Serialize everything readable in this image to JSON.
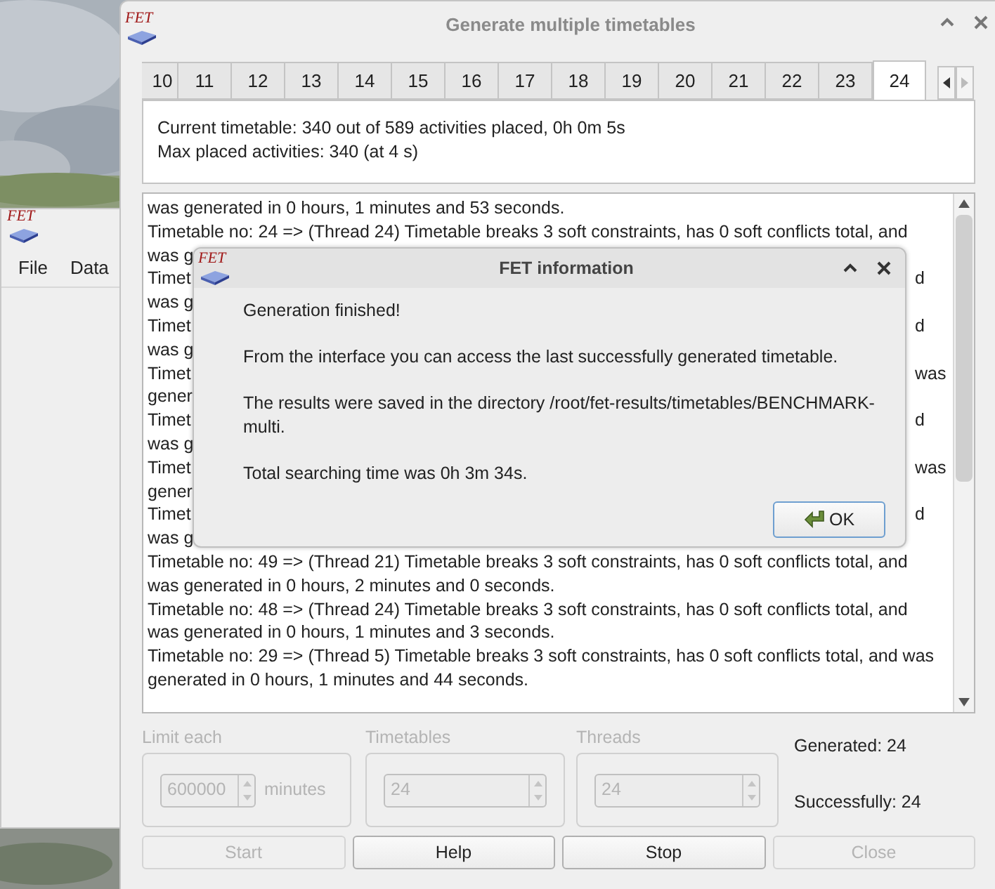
{
  "back_window": {
    "logo": "FET",
    "menu": [
      "File",
      "Data"
    ]
  },
  "window": {
    "logo": "FET",
    "title": "Generate multiple timetables"
  },
  "tabs": [
    {
      "label": "10",
      "selected": false
    },
    {
      "label": "11",
      "selected": false
    },
    {
      "label": "12",
      "selected": false
    },
    {
      "label": "13",
      "selected": false
    },
    {
      "label": "14",
      "selected": false
    },
    {
      "label": "15",
      "selected": false
    },
    {
      "label": "16",
      "selected": false
    },
    {
      "label": "17",
      "selected": false
    },
    {
      "label": "18",
      "selected": false
    },
    {
      "label": "19",
      "selected": false
    },
    {
      "label": "20",
      "selected": false
    },
    {
      "label": "21",
      "selected": false
    },
    {
      "label": "22",
      "selected": false
    },
    {
      "label": "23",
      "selected": false
    },
    {
      "label": "24",
      "selected": true
    }
  ],
  "status": [
    "Current timetable: 340 out of 589 activities placed, 0h 0m 5s",
    "Max placed activities: 340 (at 4 s)"
  ],
  "log": [
    {
      "left": "was generated in 0 hours, 1 minutes and 53 seconds."
    },
    {
      "left": "Timetable no: 24 => (Thread 24) Timetable breaks 3 soft constraints, has 0 soft conflicts total, and"
    },
    {
      "left": "was g"
    },
    {
      "left": "Timet",
      "right": "d"
    },
    {
      "left": "was g"
    },
    {
      "left": "Timet",
      "right": "d"
    },
    {
      "left": "was g"
    },
    {
      "left": "Timet",
      "right": "was"
    },
    {
      "left": "gener"
    },
    {
      "left": "Timet",
      "right": "d"
    },
    {
      "left": "was g"
    },
    {
      "left": "Timet",
      "right": "was"
    },
    {
      "left": "gener"
    },
    {
      "left": "Timet",
      "right": "d"
    },
    {
      "left": "was g"
    },
    {
      "left": "Timetable no: 49 => (Thread 21) Timetable breaks 3 soft constraints, has 0 soft conflicts total, and"
    },
    {
      "left": "was generated in 0 hours, 2 minutes and 0 seconds."
    },
    {
      "left": "Timetable no: 48 => (Thread 24) Timetable breaks 3 soft constraints, has 0 soft conflicts total, and"
    },
    {
      "left": "was generated in 0 hours, 1 minutes and 3 seconds."
    },
    {
      "left": "Timetable no: 29 => (Thread 5) Timetable breaks 3 soft constraints, has 0 soft conflicts total, and was"
    },
    {
      "left": "generated in 0 hours, 1 minutes and 44 seconds."
    }
  ],
  "settings": [
    {
      "label": "Limit each",
      "value": "600000",
      "unit": "minutes",
      "disabled": true
    },
    {
      "label": "Timetables",
      "value": "24",
      "disabled": true
    },
    {
      "label": "Threads",
      "value": "24",
      "disabled": true
    }
  ],
  "counters": [
    "Generated: 24",
    "Successfully: 24"
  ],
  "buttons": [
    {
      "label": "Start",
      "disabled": true
    },
    {
      "label": "Help",
      "disabled": false
    },
    {
      "label": "Stop",
      "disabled": false
    },
    {
      "label": "Close",
      "disabled": true
    }
  ],
  "dialog": {
    "logo": "FET",
    "title": "FET information",
    "paragraphs": [
      "Generation finished!",
      "From the interface you can access the last successfully generated timetable.",
      "The results were saved in the directory /root/fet-results/timetables/BENCHMARK-multi.",
      "Total searching time was 0h 3m 34s."
    ],
    "ok_button": "OK"
  }
}
